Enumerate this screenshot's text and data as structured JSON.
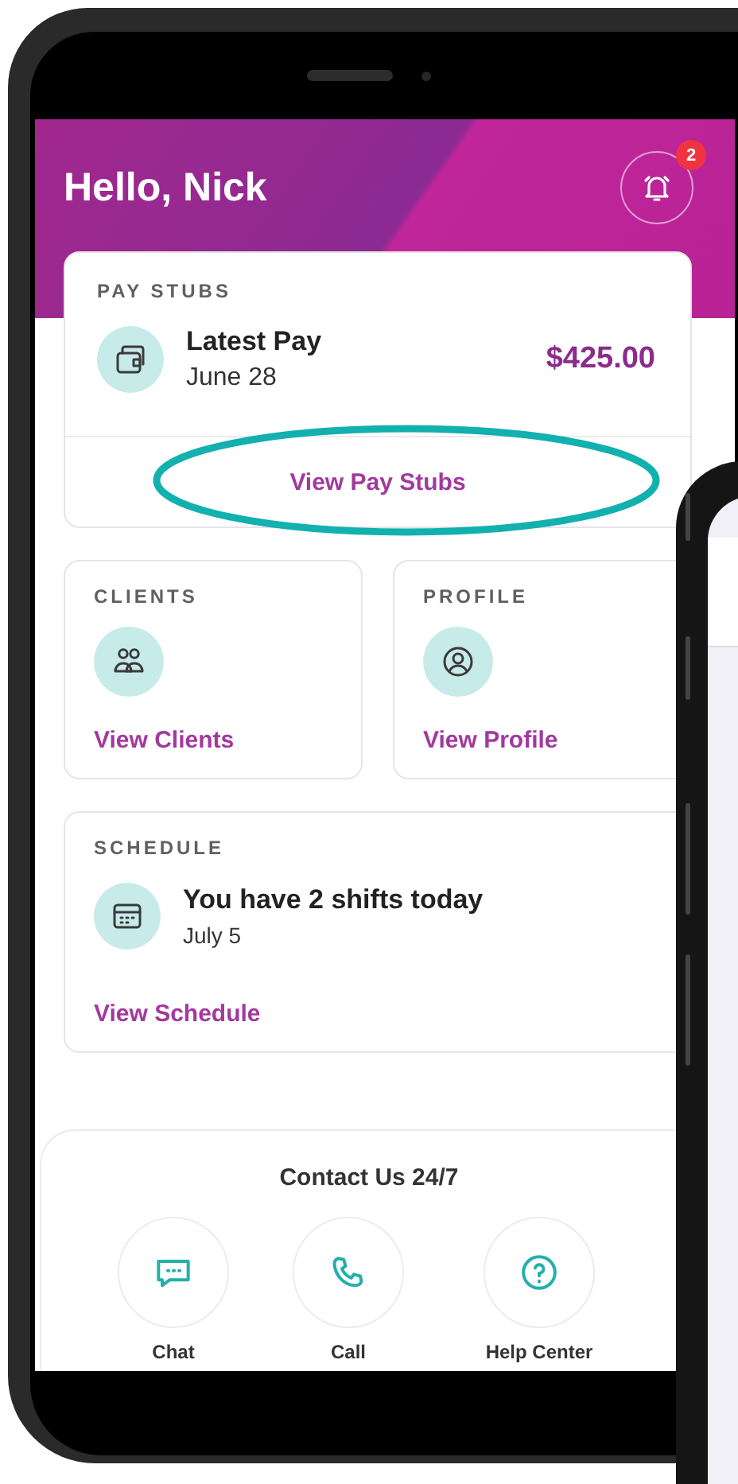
{
  "header": {
    "greeting": "Hello, Nick",
    "notification_count": "2"
  },
  "pay_stubs": {
    "heading": "PAY STUBS",
    "title": "Latest Pay",
    "date": "June 28",
    "amount": "$425.00",
    "link": "View Pay Stubs",
    "highlighted": true
  },
  "tiles": [
    {
      "heading": "CLIENTS",
      "kind": "clients",
      "link": "View Clients"
    },
    {
      "heading": "PROFILE",
      "kind": "profile",
      "link": "View Profile"
    }
  ],
  "schedule": {
    "heading": "SCHEDULE",
    "title": "You have 2 shifts today",
    "date": "July 5",
    "link": "View Schedule"
  },
  "contact": {
    "title": "Contact Us 24/7",
    "actions": [
      {
        "kind": "chat",
        "label": "Chat"
      },
      {
        "kind": "call",
        "label": "Call"
      },
      {
        "kind": "help",
        "label": "Help Center"
      }
    ]
  }
}
